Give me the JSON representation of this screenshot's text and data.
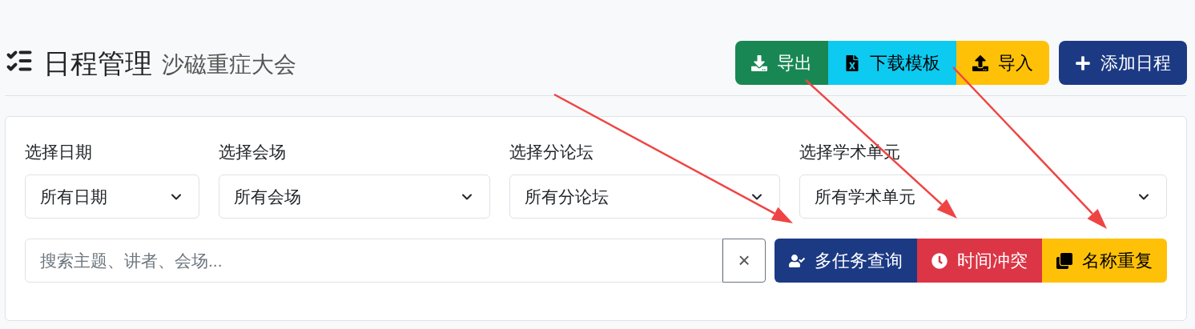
{
  "header": {
    "title": "日程管理",
    "subtitle": "沙磁重症大会"
  },
  "toolbar": {
    "group": [
      {
        "kind": "success",
        "label": "导出"
      },
      {
        "kind": "info",
        "label": "下载模板"
      },
      {
        "kind": "warning",
        "label": "导入"
      }
    ],
    "add_button": {
      "kind": "primary",
      "label": "添加日程"
    }
  },
  "filters": [
    {
      "label": "选择日期",
      "value": "所有日期"
    },
    {
      "label": "选择会场",
      "value": "所有会场"
    },
    {
      "label": "选择分论坛",
      "value": "所有分论坛"
    },
    {
      "label": "选择学术单元",
      "value": "所有学术单元"
    }
  ],
  "search": {
    "placeholder": "搜索主题、讲者、会场...",
    "clear": "×"
  },
  "actions": [
    {
      "kind": "primary",
      "label": "多任务查询"
    },
    {
      "kind": "danger",
      "label": "时间冲突"
    },
    {
      "kind": "warning",
      "label": "名称重复"
    }
  ]
}
